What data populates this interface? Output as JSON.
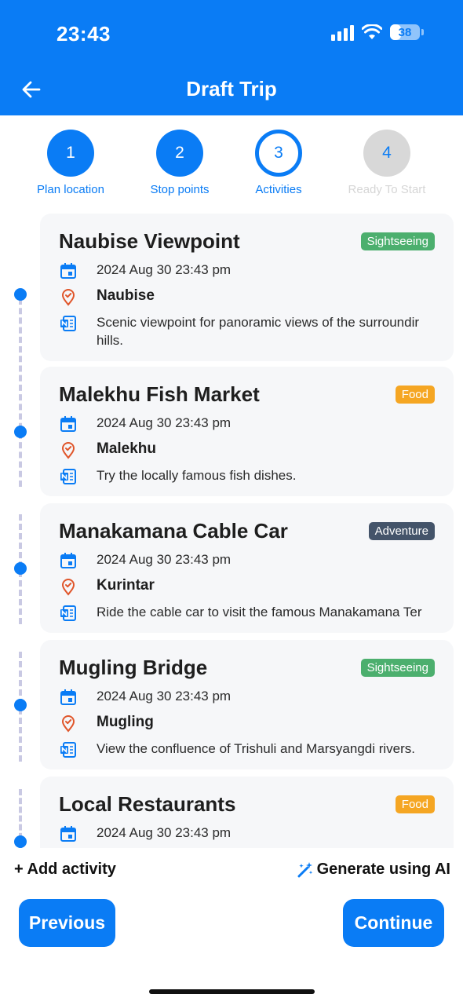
{
  "status_bar": {
    "time": "23:43",
    "battery": "38",
    "battery_level": 0.38
  },
  "header": {
    "title": "Draft Trip",
    "back_icon": "arrow-left-icon"
  },
  "stepper": [
    {
      "number": "1",
      "label": "Plan location",
      "state": "done"
    },
    {
      "number": "2",
      "label": "Stop points",
      "state": "done"
    },
    {
      "number": "3",
      "label": "Activities",
      "state": "current"
    },
    {
      "number": "4",
      "label": "Ready To Start",
      "state": "pending"
    }
  ],
  "activities": [
    {
      "title": "Naubise Viewpoint",
      "category": "Sightseeing",
      "category_color": "#4caf6e",
      "datetime": "2024 Aug 30 23:43 pm",
      "location": "Naubise",
      "note": "Scenic viewpoint for panoramic views of the surroundir hills."
    },
    {
      "title": "Malekhu Fish Market",
      "category": "Food",
      "category_color": "#f5a623",
      "datetime": "2024 Aug 30 23:43 pm",
      "location": "Malekhu",
      "note": "Try the locally famous fish dishes."
    },
    {
      "title": "Manakamana Cable Car",
      "category": "Adventure",
      "category_color": "#44546a",
      "datetime": "2024 Aug 30 23:43 pm",
      "location": "Kurintar",
      "note": "Ride the cable car to visit the famous Manakamana Ter"
    },
    {
      "title": "Mugling Bridge",
      "category": "Sightseeing",
      "category_color": "#4caf6e",
      "datetime": "2024 Aug 30 23:43 pm",
      "location": "Mugling",
      "note": "View the confluence of Trishuli and Marsyangdi rivers."
    },
    {
      "title": "Local Restaurants",
      "category": "Food",
      "category_color": "#f5a623",
      "datetime": "2024 Aug 30 23:43 pm"
    }
  ],
  "actions": {
    "add_activity": "+ Add activity",
    "generate_ai": "Generate using AI",
    "previous": "Previous",
    "continue": "Continue"
  },
  "colors": {
    "primary": "#0a7cf5",
    "location_icon": "#e0562b",
    "card_bg": "#f6f7f9",
    "timeline_dash": "#c9c9e3"
  }
}
